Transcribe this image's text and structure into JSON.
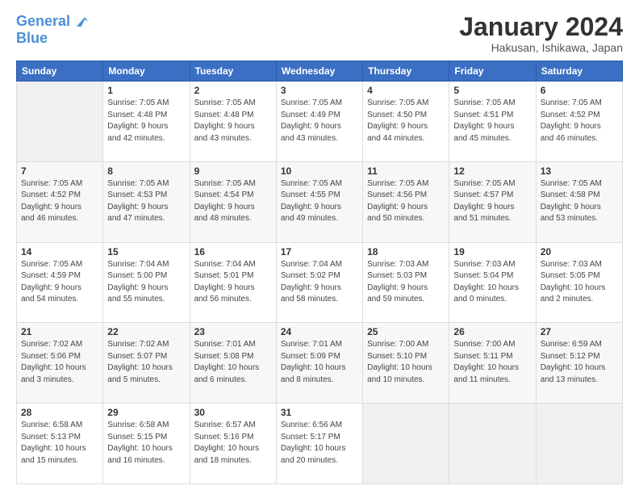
{
  "header": {
    "logo_line1": "General",
    "logo_line2": "Blue",
    "title": "January 2024",
    "subtitle": "Hakusan, Ishikawa, Japan"
  },
  "calendar": {
    "days_of_week": [
      "Sunday",
      "Monday",
      "Tuesday",
      "Wednesday",
      "Thursday",
      "Friday",
      "Saturday"
    ],
    "weeks": [
      [
        {
          "num": "",
          "info": ""
        },
        {
          "num": "1",
          "info": "Sunrise: 7:05 AM\nSunset: 4:48 PM\nDaylight: 9 hours\nand 42 minutes."
        },
        {
          "num": "2",
          "info": "Sunrise: 7:05 AM\nSunset: 4:48 PM\nDaylight: 9 hours\nand 43 minutes."
        },
        {
          "num": "3",
          "info": "Sunrise: 7:05 AM\nSunset: 4:49 PM\nDaylight: 9 hours\nand 43 minutes."
        },
        {
          "num": "4",
          "info": "Sunrise: 7:05 AM\nSunset: 4:50 PM\nDaylight: 9 hours\nand 44 minutes."
        },
        {
          "num": "5",
          "info": "Sunrise: 7:05 AM\nSunset: 4:51 PM\nDaylight: 9 hours\nand 45 minutes."
        },
        {
          "num": "6",
          "info": "Sunrise: 7:05 AM\nSunset: 4:52 PM\nDaylight: 9 hours\nand 46 minutes."
        }
      ],
      [
        {
          "num": "7",
          "info": "Sunrise: 7:05 AM\nSunset: 4:52 PM\nDaylight: 9 hours\nand 46 minutes."
        },
        {
          "num": "8",
          "info": "Sunrise: 7:05 AM\nSunset: 4:53 PM\nDaylight: 9 hours\nand 47 minutes."
        },
        {
          "num": "9",
          "info": "Sunrise: 7:05 AM\nSunset: 4:54 PM\nDaylight: 9 hours\nand 48 minutes."
        },
        {
          "num": "10",
          "info": "Sunrise: 7:05 AM\nSunset: 4:55 PM\nDaylight: 9 hours\nand 49 minutes."
        },
        {
          "num": "11",
          "info": "Sunrise: 7:05 AM\nSunset: 4:56 PM\nDaylight: 9 hours\nand 50 minutes."
        },
        {
          "num": "12",
          "info": "Sunrise: 7:05 AM\nSunset: 4:57 PM\nDaylight: 9 hours\nand 51 minutes."
        },
        {
          "num": "13",
          "info": "Sunrise: 7:05 AM\nSunset: 4:58 PM\nDaylight: 9 hours\nand 53 minutes."
        }
      ],
      [
        {
          "num": "14",
          "info": "Sunrise: 7:05 AM\nSunset: 4:59 PM\nDaylight: 9 hours\nand 54 minutes."
        },
        {
          "num": "15",
          "info": "Sunrise: 7:04 AM\nSunset: 5:00 PM\nDaylight: 9 hours\nand 55 minutes."
        },
        {
          "num": "16",
          "info": "Sunrise: 7:04 AM\nSunset: 5:01 PM\nDaylight: 9 hours\nand 56 minutes."
        },
        {
          "num": "17",
          "info": "Sunrise: 7:04 AM\nSunset: 5:02 PM\nDaylight: 9 hours\nand 58 minutes."
        },
        {
          "num": "18",
          "info": "Sunrise: 7:03 AM\nSunset: 5:03 PM\nDaylight: 9 hours\nand 59 minutes."
        },
        {
          "num": "19",
          "info": "Sunrise: 7:03 AM\nSunset: 5:04 PM\nDaylight: 10 hours\nand 0 minutes."
        },
        {
          "num": "20",
          "info": "Sunrise: 7:03 AM\nSunset: 5:05 PM\nDaylight: 10 hours\nand 2 minutes."
        }
      ],
      [
        {
          "num": "21",
          "info": "Sunrise: 7:02 AM\nSunset: 5:06 PM\nDaylight: 10 hours\nand 3 minutes."
        },
        {
          "num": "22",
          "info": "Sunrise: 7:02 AM\nSunset: 5:07 PM\nDaylight: 10 hours\nand 5 minutes."
        },
        {
          "num": "23",
          "info": "Sunrise: 7:01 AM\nSunset: 5:08 PM\nDaylight: 10 hours\nand 6 minutes."
        },
        {
          "num": "24",
          "info": "Sunrise: 7:01 AM\nSunset: 5:09 PM\nDaylight: 10 hours\nand 8 minutes."
        },
        {
          "num": "25",
          "info": "Sunrise: 7:00 AM\nSunset: 5:10 PM\nDaylight: 10 hours\nand 10 minutes."
        },
        {
          "num": "26",
          "info": "Sunrise: 7:00 AM\nSunset: 5:11 PM\nDaylight: 10 hours\nand 11 minutes."
        },
        {
          "num": "27",
          "info": "Sunrise: 6:59 AM\nSunset: 5:12 PM\nDaylight: 10 hours\nand 13 minutes."
        }
      ],
      [
        {
          "num": "28",
          "info": "Sunrise: 6:58 AM\nSunset: 5:13 PM\nDaylight: 10 hours\nand 15 minutes."
        },
        {
          "num": "29",
          "info": "Sunrise: 6:58 AM\nSunset: 5:15 PM\nDaylight: 10 hours\nand 16 minutes."
        },
        {
          "num": "30",
          "info": "Sunrise: 6:57 AM\nSunset: 5:16 PM\nDaylight: 10 hours\nand 18 minutes."
        },
        {
          "num": "31",
          "info": "Sunrise: 6:56 AM\nSunset: 5:17 PM\nDaylight: 10 hours\nand 20 minutes."
        },
        {
          "num": "",
          "info": ""
        },
        {
          "num": "",
          "info": ""
        },
        {
          "num": "",
          "info": ""
        }
      ]
    ]
  }
}
